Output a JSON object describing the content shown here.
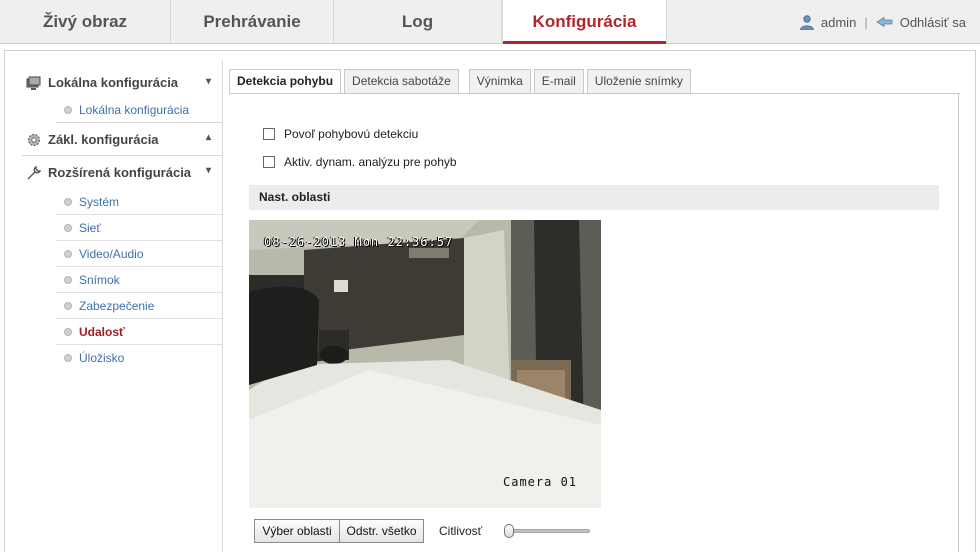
{
  "nav": {
    "tabs": [
      "Živý obraz",
      "Prehrávanie",
      "Log",
      "Konfigurácia"
    ],
    "active_tab": "Konfigurácia",
    "user": "admin",
    "separator": "|",
    "logout": "Odhlásiť sa",
    "accent_color": "#b0262c"
  },
  "sidebar": {
    "sections": [
      {
        "label": "Lokálna konfigurácia",
        "icon": "monitor-icon",
        "chevron": "▾",
        "items": [
          "Lokálna konfigurácia"
        ]
      },
      {
        "label": "Zákl. konfigurácia",
        "icon": "gear-icon",
        "chevron": "▴",
        "items": []
      },
      {
        "label": "Rozšírená konfigurácia",
        "icon": "wrench-icon",
        "chevron": "▾",
        "items": [
          "Systém",
          "Sieť",
          "Video/Audio",
          "Snímok",
          "Zabezpečenie",
          "Udalosť",
          "Úložisko"
        ]
      }
    ],
    "active_item": "Udalosť"
  },
  "tabs": [
    "Detekcia pohybu",
    "Detekcia sabotáže",
    "Výnimka",
    "E-mail",
    "Uloženie snímky"
  ],
  "active_tab": "Detekcia pohybu",
  "options": {
    "enable_motion": {
      "label": "Povoľ pohybovú detekciu",
      "checked": false
    },
    "dynamic_analysis": {
      "label": "Aktiv. dynam. analýzu pre pohyb",
      "checked": false
    }
  },
  "area": {
    "title": "Nast. oblasti",
    "osd_time": "08-26-2013 Mon 22:36:57",
    "osd_camera": "Camera 01"
  },
  "controls": {
    "select_area": "Výber oblasti",
    "clear_all": "Odstr. všetko",
    "sensitivity_label": "Citlivosť",
    "sensitivity_value": 0
  }
}
